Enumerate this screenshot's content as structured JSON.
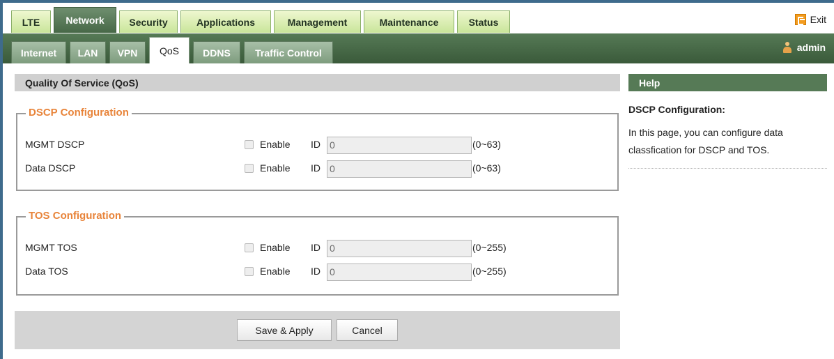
{
  "top_tabs": [
    {
      "label": "LTE"
    },
    {
      "label": "Network"
    },
    {
      "label": "Security"
    },
    {
      "label": "Applications"
    },
    {
      "label": "Management"
    },
    {
      "label": "Maintenance"
    },
    {
      "label": "Status"
    }
  ],
  "active_top_tab": "Network",
  "exit": {
    "label": "Exit",
    "icon": "exit-icon"
  },
  "sub_tabs": [
    {
      "label": "Internet"
    },
    {
      "label": "LAN"
    },
    {
      "label": "VPN"
    },
    {
      "label": "QoS"
    },
    {
      "label": "DDNS"
    },
    {
      "label": "Traffic Control"
    }
  ],
  "active_sub_tab": "QoS",
  "user": {
    "name": "admin",
    "icon": "user-icon"
  },
  "main": {
    "title": "Quality Of Service (QoS)",
    "dscp": {
      "legend": "DSCP Configuration",
      "rows": [
        {
          "label": "MGMT DSCP",
          "enable_label": "Enable",
          "enabled": false,
          "id_label": "ID",
          "id_value": "0",
          "range": "(0~63)"
        },
        {
          "label": "Data DSCP",
          "enable_label": "Enable",
          "enabled": false,
          "id_label": "ID",
          "id_value": "0",
          "range": "(0~63)"
        }
      ]
    },
    "tos": {
      "legend": "TOS Configuration",
      "rows": [
        {
          "label": "MGMT TOS",
          "enable_label": "Enable",
          "enabled": false,
          "id_label": "ID",
          "id_value": "0",
          "range": "(0~255)"
        },
        {
          "label": "Data TOS",
          "enable_label": "Enable",
          "enabled": false,
          "id_label": "ID",
          "id_value": "0",
          "range": "(0~255)"
        }
      ]
    },
    "buttons": {
      "save": "Save & Apply",
      "cancel": "Cancel"
    }
  },
  "help": {
    "header": "Help",
    "title": "DSCP Configuration:",
    "text": "In this page, you can configure data classfication for DSCP and TOS."
  },
  "colors": {
    "accent_green": "#567a56",
    "legend_orange": "#e8843a",
    "exit_orange": "#f39c1f"
  }
}
